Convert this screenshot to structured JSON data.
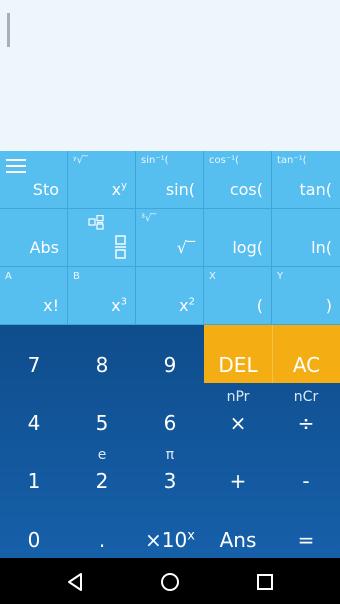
{
  "display": {
    "expression": ""
  },
  "scientific_keys": [
    {
      "name": "menu-sto",
      "secondary": "",
      "main": "Sto",
      "icon": "hamburger-icon"
    },
    {
      "name": "power-key",
      "secondary": "ʸ√‾",
      "main": "x",
      "sup": "y"
    },
    {
      "name": "sin-key",
      "secondary": "sin⁻¹(",
      "main": "sin("
    },
    {
      "name": "cos-key",
      "secondary": "cos⁻¹(",
      "main": "cos("
    },
    {
      "name": "tan-key",
      "secondary": "tan⁻¹(",
      "main": "tan("
    },
    {
      "name": "abs-key",
      "secondary": "",
      "main": "Abs"
    },
    {
      "name": "fraction-key",
      "secondary": "",
      "main": "",
      "icon": "fraction-icon"
    },
    {
      "name": "root-key",
      "secondary": "³√‾",
      "main": "√‾"
    },
    {
      "name": "log-key",
      "secondary": "",
      "main": "log("
    },
    {
      "name": "ln-key",
      "secondary": "",
      "main": "ln("
    },
    {
      "name": "factorial-key",
      "secondary": "A",
      "main": "x!"
    },
    {
      "name": "cube-key",
      "secondary": "B",
      "main": "x",
      "sup": "3"
    },
    {
      "name": "square-key",
      "secondary": "",
      "main": "x",
      "sup": "2"
    },
    {
      "name": "open-paren-key",
      "secondary": "X",
      "main": "("
    },
    {
      "name": "close-paren-key",
      "secondary": "Y",
      "main": ")"
    }
  ],
  "number_keys": [
    {
      "name": "key-7",
      "secondary": "",
      "main": "7"
    },
    {
      "name": "key-8",
      "secondary": "",
      "main": "8"
    },
    {
      "name": "key-9",
      "secondary": "",
      "main": "9"
    },
    {
      "name": "delete-button",
      "secondary": "",
      "main": "DEL",
      "accent": true
    },
    {
      "name": "all-clear-button",
      "secondary": "",
      "main": "AC",
      "accent": true
    },
    {
      "name": "key-4",
      "secondary": "",
      "main": "4"
    },
    {
      "name": "key-5",
      "secondary": "",
      "main": "5"
    },
    {
      "name": "key-6",
      "secondary": "",
      "main": "6"
    },
    {
      "name": "multiply-key",
      "secondary": "nPr",
      "main": "×"
    },
    {
      "name": "divide-key",
      "secondary": "nCr",
      "main": "÷"
    },
    {
      "name": "key-1",
      "secondary": "",
      "main": "1"
    },
    {
      "name": "key-2",
      "secondary": "e",
      "main": "2"
    },
    {
      "name": "key-3",
      "secondary": "π",
      "main": "3"
    },
    {
      "name": "plus-key",
      "secondary": "",
      "main": "+"
    },
    {
      "name": "minus-key",
      "secondary": "",
      "main": "-"
    },
    {
      "name": "key-0",
      "secondary": "",
      "main": "0"
    },
    {
      "name": "decimal-key",
      "secondary": "",
      "main": "."
    },
    {
      "name": "exponent-key",
      "secondary": "",
      "main": "×10",
      "sup": "x"
    },
    {
      "name": "ans-key",
      "secondary": "",
      "main": "Ans"
    },
    {
      "name": "equals-key",
      "secondary": "",
      "main": "="
    }
  ],
  "navbar": {
    "buttons": [
      "back-icon",
      "home-icon",
      "recents-icon"
    ]
  },
  "colors": {
    "display_bg": "#eef5fb",
    "scientific_bg": "#56bff0",
    "numpad_bg": "#1660aa",
    "accent": "#f4ae14"
  }
}
